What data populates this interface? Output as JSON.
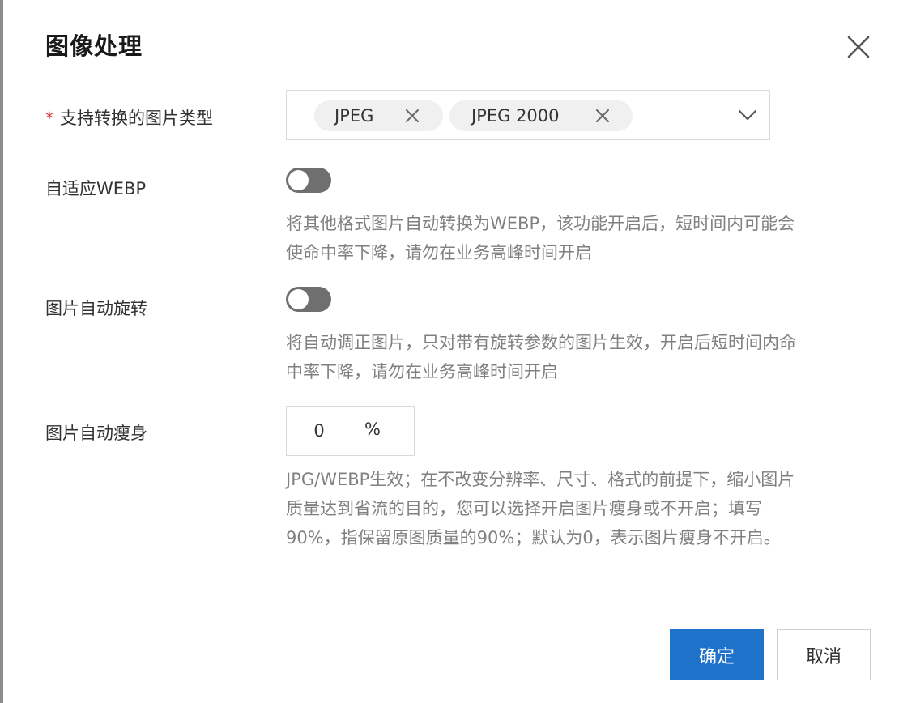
{
  "dialog": {
    "title": "图像处理",
    "close_icon": "close-icon"
  },
  "image_types": {
    "required_mark": "*",
    "label": "支持转换的图片类型",
    "selected": [
      "JPEG",
      "JPEG 2000"
    ],
    "remove_icon": "close-icon",
    "dropdown_icon": "chevron-down-icon"
  },
  "webp": {
    "label": "自适应WEBP",
    "enabled": false,
    "help_lines": [
      "将其他格式图片自动转换为WEBP，该功能开启后，短时间内可能会",
      "使命中率下降，请勿在业务高峰时间开启"
    ]
  },
  "rotate": {
    "label": "图片自动旋转",
    "enabled": false,
    "help_lines": [
      "将自动调正图片，只对带有旋转参数的图片生效，开启后短时间内命",
      "中率下降，请勿在业务高峰时间开启"
    ]
  },
  "slimming": {
    "label": "图片自动瘦身",
    "value": "0",
    "suffix": "%",
    "help_lines": [
      "JPG/WEBP生效；在不改变分辨率、尺寸、格式的前提下，缩小图片",
      "质量达到省流的目的，您可以选择开启图片瘦身或不开启；填写",
      "90%，指保留原图质量的90%；默认为0，表示图片瘦身不开启。"
    ]
  },
  "footer": {
    "confirm_label": "确定",
    "cancel_label": "取消"
  },
  "colors": {
    "primary": "#1f72c9",
    "required": "#d9363e",
    "toggle_off": "#6f6f6f",
    "help_text": "#808080"
  }
}
